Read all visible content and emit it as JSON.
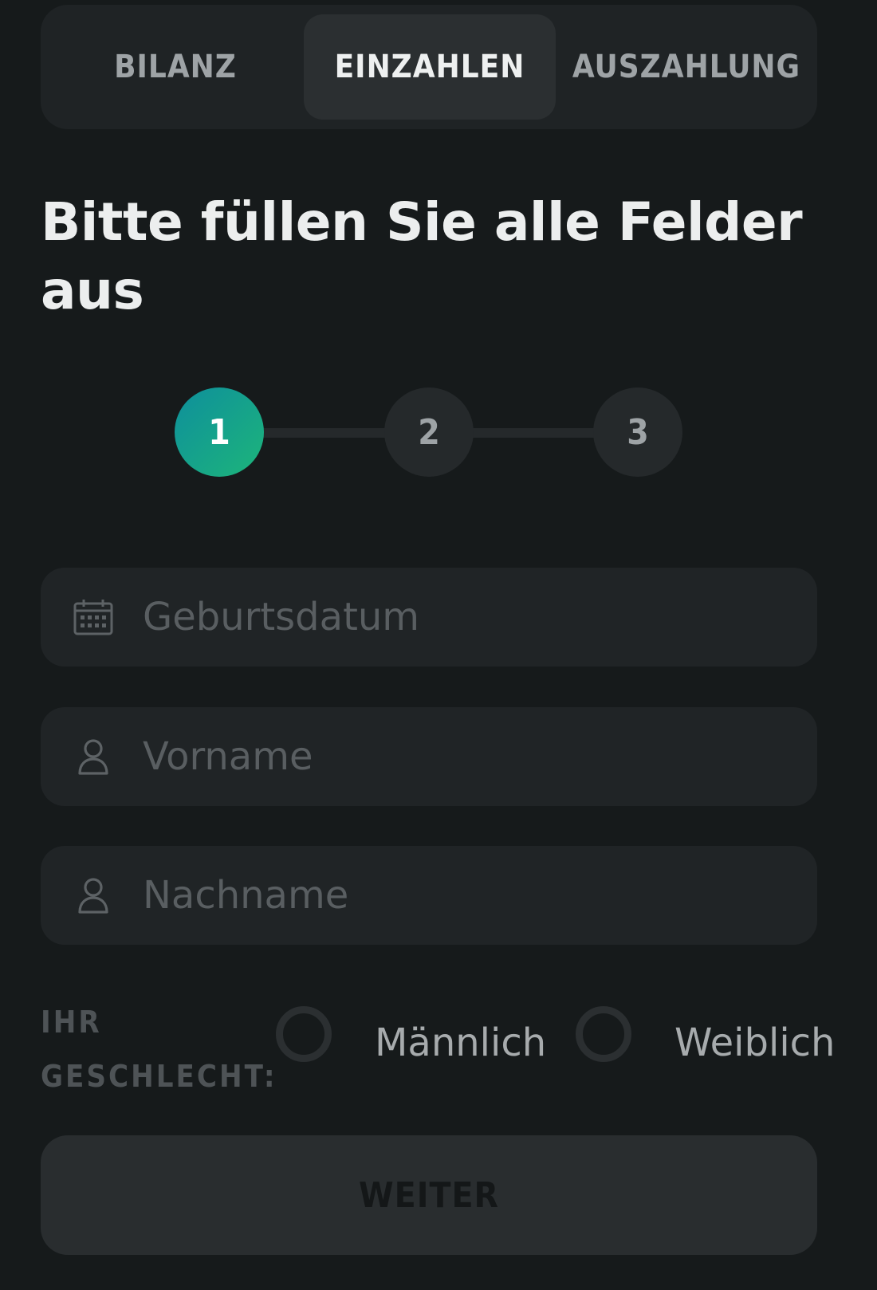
{
  "tabs": [
    {
      "label": "BILANZ",
      "active": false
    },
    {
      "label": "EINZAHLEN",
      "active": true
    },
    {
      "label": "AUSZAHLUNG",
      "active": false
    }
  ],
  "form": {
    "heading": "Bitte füllen Sie alle Felder aus",
    "steps": [
      {
        "label": "1",
        "active": true
      },
      {
        "label": "2",
        "active": false
      },
      {
        "label": "3",
        "active": false
      }
    ],
    "fields": {
      "birthdate": {
        "icon": "calendar-icon",
        "placeholder": "Geburtsdatum",
        "value": ""
      },
      "first_name": {
        "icon": "user-icon",
        "placeholder": "Vorname",
        "value": ""
      },
      "last_name": {
        "icon": "user-icon",
        "placeholder": "Nachname",
        "value": ""
      }
    },
    "gender": {
      "label": "IHR GESCHLECHT:",
      "options": [
        {
          "label": "Männlich",
          "selected": false
        },
        {
          "label": "Weiblich",
          "selected": false
        }
      ]
    },
    "submit_label": "WEITER"
  },
  "colors": {
    "background": "#161a1b",
    "surface": "#1f2325",
    "active_step_gradient_start": "#0e8f9c",
    "active_step_gradient_end": "#1db57a"
  }
}
